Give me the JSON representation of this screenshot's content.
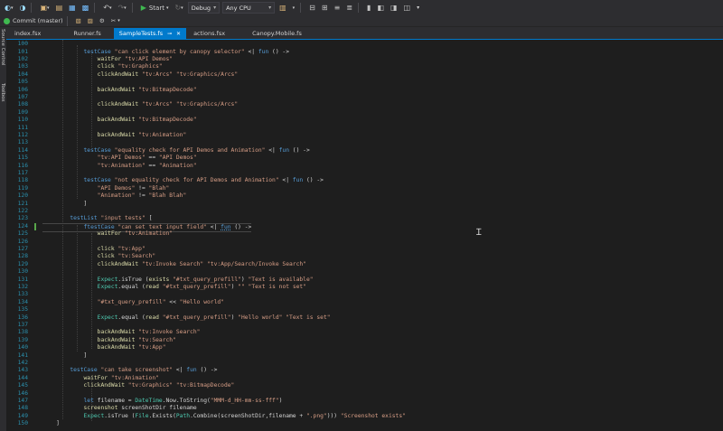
{
  "toolbar": {
    "start_label": "Start",
    "config_value": "Debug",
    "platform_value": "Any CPU"
  },
  "branch": {
    "label": "Commit (master)"
  },
  "side_tabs": [
    "Source Control",
    "Toolbox"
  ],
  "tabs": [
    {
      "label": "index.fsx",
      "active": false
    },
    {
      "label": "Runner.fs",
      "active": false
    },
    {
      "label": "SampleTests.fs",
      "active": true
    },
    {
      "label": "actions.fsx",
      "active": false
    },
    {
      "label": "Canopy.Mobile.fs",
      "active": false
    }
  ],
  "editor": {
    "lines": [
      {
        "n": "100",
        "code": ""
      },
      {
        "n": "101",
        "code": "            testCase \"can click element by canopy selector\" <| fun () ->"
      },
      {
        "n": "102",
        "code": "                waitFor \"tv:API Demos\""
      },
      {
        "n": "103",
        "code": "                click \"tv:Graphics\""
      },
      {
        "n": "104",
        "code": "                clickAndWait \"tv:Arcs\" \"tv:Graphics/Arcs\""
      },
      {
        "n": "105",
        "code": ""
      },
      {
        "n": "106",
        "code": "                backAndWait \"tv:BitmapDecode\""
      },
      {
        "n": "107",
        "code": ""
      },
      {
        "n": "108",
        "code": "                clickAndWait \"tv:Arcs\" \"tv:Graphics/Arcs\""
      },
      {
        "n": "109",
        "code": ""
      },
      {
        "n": "110",
        "code": "                backAndWait \"tv:BitmapDecode\""
      },
      {
        "n": "111",
        "code": ""
      },
      {
        "n": "112",
        "code": "                backAndWait \"tv:Animation\""
      },
      {
        "n": "113",
        "code": ""
      },
      {
        "n": "114",
        "code": "            testCase \"equality check for API Demos and Animation\" <| fun () ->"
      },
      {
        "n": "115",
        "code": "                \"tv:API Demos\" == \"API Demos\""
      },
      {
        "n": "116",
        "code": "                \"tv:Animation\" == \"Animation\""
      },
      {
        "n": "117",
        "code": ""
      },
      {
        "n": "118",
        "code": "            testCase \"not equality check for API Demos and Animation\" <| fun () ->"
      },
      {
        "n": "119",
        "code": "                \"API Demos\" != \"Blah\""
      },
      {
        "n": "120",
        "code": "                \"Animation\" != \"Blah Blah\""
      },
      {
        "n": "121",
        "code": "            ]"
      },
      {
        "n": "122",
        "code": ""
      },
      {
        "n": "123",
        "code": "        testList \"input tests\" ["
      },
      {
        "n": "124",
        "code": "            ftestCase \"can set text input field\" <| fun () ->"
      },
      {
        "n": "125",
        "code": "                waitFor \"tv:Animation\""
      },
      {
        "n": "126",
        "code": ""
      },
      {
        "n": "127",
        "code": "                click \"tv:App\""
      },
      {
        "n": "128",
        "code": "                click \"tv:Search\""
      },
      {
        "n": "129",
        "code": "                clickAndWait \"tv:Invoke Search\" \"tv:App/Search/Invoke Search\""
      },
      {
        "n": "130",
        "code": ""
      },
      {
        "n": "131",
        "code": "                Expect.isTrue (exists \"#txt_query_prefill\") \"Text is available\""
      },
      {
        "n": "132",
        "code": "                Expect.equal (read \"#txt_query_prefill\") \"\" \"Text is not set\""
      },
      {
        "n": "133",
        "code": ""
      },
      {
        "n": "134",
        "code": "                \"#txt_query_prefill\" << \"Hello world\""
      },
      {
        "n": "135",
        "code": ""
      },
      {
        "n": "136",
        "code": "                Expect.equal (read \"#txt_query_prefill\") \"Hello world\" \"Text is set\""
      },
      {
        "n": "137",
        "code": ""
      },
      {
        "n": "138",
        "code": "                backAndWait \"tv:Invoke Search\""
      },
      {
        "n": "139",
        "code": "                backAndWait \"tv:Search\""
      },
      {
        "n": "140",
        "code": "                backAndWait \"tv:App\""
      },
      {
        "n": "141",
        "code": "            ]"
      },
      {
        "n": "142",
        "code": ""
      },
      {
        "n": "143",
        "code": "        testCase \"can take screenshot\" <| fun () ->"
      },
      {
        "n": "144",
        "code": "            waitFor \"tv:Animation\""
      },
      {
        "n": "145",
        "code": "            clickAndWait \"tv:Graphics\" \"tv:BitmapDecode\""
      },
      {
        "n": "146",
        "code": ""
      },
      {
        "n": "147",
        "code": "            let filename = DateTime.Now.ToString(\"MMM-d_HH-mm-ss-fff\")"
      },
      {
        "n": "148",
        "code": "            screenshot screenShotDir filename"
      },
      {
        "n": "149",
        "code": "            Expect.isTrue (File.Exists(Path.Combine(screenShotDir,filename + \".png\"))) \"Screenshot exists\""
      },
      {
        "n": "150",
        "code": "    ]"
      }
    ],
    "current_line": "124"
  },
  "colors": {
    "accent": "#007acc",
    "keyword": "#569cd6",
    "string": "#d69d85",
    "function": "#dcdcaa",
    "type": "#4ec9b0",
    "line_number": "#2b91af",
    "background": "#1e1e1e"
  }
}
